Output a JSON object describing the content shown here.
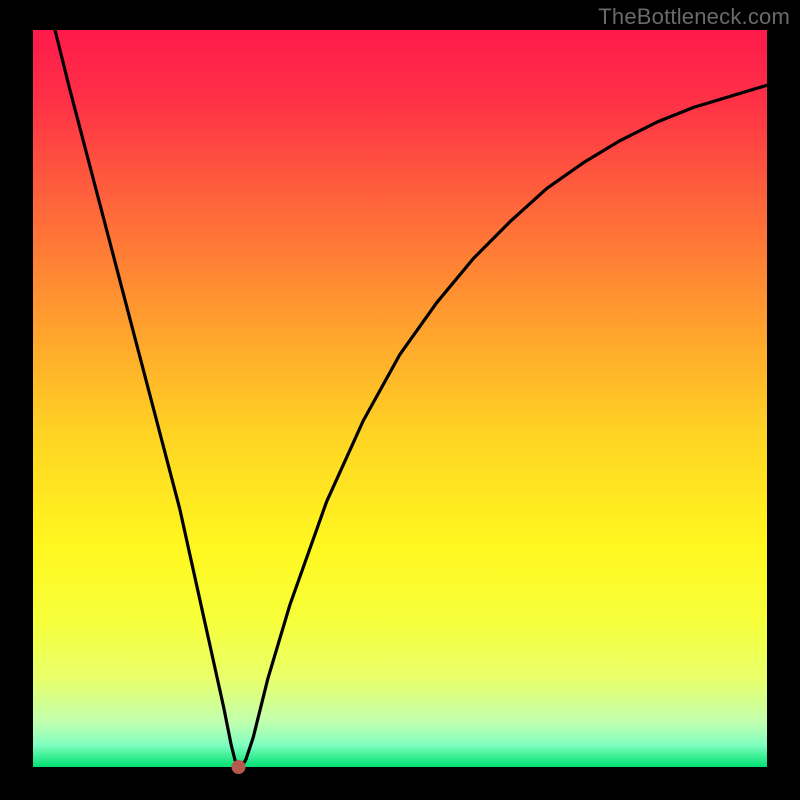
{
  "watermark": "TheBottleneck.com",
  "chart_data": {
    "type": "line",
    "title": "",
    "xlabel": "",
    "ylabel": "",
    "xlim": [
      0,
      100
    ],
    "ylim": [
      0,
      100
    ],
    "grid": false,
    "legend": false,
    "minimum_marker": {
      "x": 28,
      "y": 0
    },
    "series": [
      {
        "name": "curve",
        "x": [
          3,
          5,
          10,
          15,
          20,
          24,
          26,
          27,
          27.5,
          28,
          28.5,
          29,
          30,
          32,
          35,
          40,
          45,
          50,
          55,
          60,
          65,
          70,
          75,
          80,
          85,
          90,
          95,
          100
        ],
        "values": [
          100,
          92,
          73,
          54,
          35,
          17,
          8,
          3,
          1,
          0,
          0.2,
          1,
          4,
          12,
          22,
          36,
          47,
          56,
          63,
          69,
          74,
          78.5,
          82,
          85,
          87.5,
          89.5,
          91,
          92.5
        ]
      }
    ],
    "gradient_stops": [
      {
        "offset": 0.0,
        "color": "#ff1a4b"
      },
      {
        "offset": 0.1,
        "color": "#ff3246"
      },
      {
        "offset": 0.25,
        "color": "#ff6a3a"
      },
      {
        "offset": 0.4,
        "color": "#ffa02e"
      },
      {
        "offset": 0.55,
        "color": "#ffd423"
      },
      {
        "offset": 0.7,
        "color": "#fff71f"
      },
      {
        "offset": 0.8,
        "color": "#f7ff3a"
      },
      {
        "offset": 0.88,
        "color": "#e8ff6a"
      },
      {
        "offset": 0.94,
        "color": "#c0ffb0"
      },
      {
        "offset": 0.97,
        "color": "#80ffc0"
      },
      {
        "offset": 1.0,
        "color": "#00e070"
      }
    ],
    "marker_color": "#b6594f"
  }
}
